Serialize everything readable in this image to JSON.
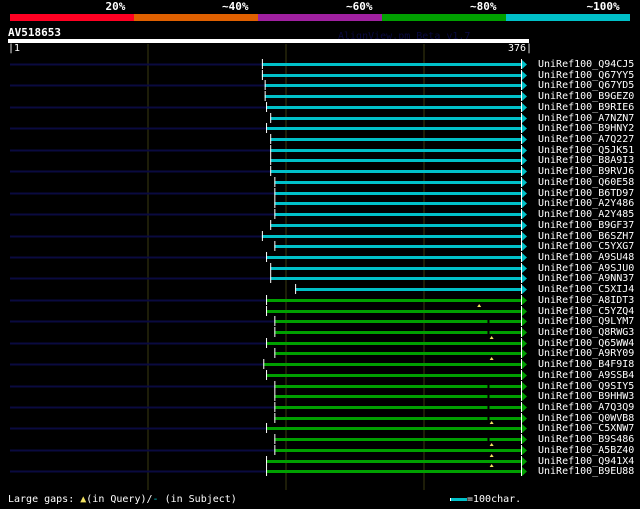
{
  "color_scale": [
    {
      "label": "20%",
      "color": "#ff0022"
    },
    {
      "label": "~40%",
      "color": "#e06000"
    },
    {
      "label": "~60%",
      "color": "#a020a0"
    },
    {
      "label": "~80%",
      "color": "#00a000"
    },
    {
      "label": "~100%",
      "color": "#00c0c8"
    }
  ],
  "query": {
    "id": "AV518653",
    "start_label": "|1",
    "end_label": "376|",
    "length": 376
  },
  "version_text": "AlignView.pm Beta v1.7",
  "legend": {
    "gaps_prefix": "Large gaps: ",
    "query_gap": "(in Query)/",
    "subject_gap": "(in Subject)",
    "scale_label": "=100char."
  },
  "chart_data": {
    "type": "alignment",
    "x_range": [
      1,
      376
    ],
    "hits": [
      {
        "label": "UniRef100_Q94CJ5",
        "start": 183,
        "end": 370,
        "identity": "~100%"
      },
      {
        "label": "UniRef100_Q67YY5",
        "start": 183,
        "end": 370,
        "identity": "~100%"
      },
      {
        "label": "UniRef100_Q67YD5",
        "start": 185,
        "end": 370,
        "identity": "~100%"
      },
      {
        "label": "UniRef100_B9GEZ0",
        "start": 185,
        "end": 370,
        "identity": "~100%"
      },
      {
        "label": "UniRef100_B9RIE6",
        "start": 186,
        "end": 370,
        "identity": "~100%"
      },
      {
        "label": "UniRef100_A7NZN7",
        "start": 189,
        "end": 370,
        "identity": "~100%"
      },
      {
        "label": "UniRef100_B9HNY2",
        "start": 186,
        "end": 370,
        "identity": "~100%"
      },
      {
        "label": "UniRef100_A7Q227",
        "start": 189,
        "end": 370,
        "identity": "~100%"
      },
      {
        "label": "UniRef100_Q5JK51",
        "start": 189,
        "end": 370,
        "identity": "~100%"
      },
      {
        "label": "UniRef100_B8A9I3",
        "start": 189,
        "end": 370,
        "identity": "~100%"
      },
      {
        "label": "UniRef100_B9RVJ6",
        "start": 189,
        "end": 370,
        "identity": "~100%"
      },
      {
        "label": "UniRef100_Q60E58",
        "start": 192,
        "end": 370,
        "identity": "~100%"
      },
      {
        "label": "UniRef100_B6TD97",
        "start": 192,
        "end": 370,
        "identity": "~100%"
      },
      {
        "label": "UniRef100_A2Y486",
        "start": 192,
        "end": 370,
        "identity": "~100%"
      },
      {
        "label": "UniRef100_A2Y485",
        "start": 192,
        "end": 370,
        "identity": "~100%"
      },
      {
        "label": "UniRef100_B9GF37",
        "start": 189,
        "end": 370,
        "identity": "~100%"
      },
      {
        "label": "UniRef100_B6SZH7",
        "start": 183,
        "end": 370,
        "identity": "~100%"
      },
      {
        "label": "UniRef100_C5YXG7",
        "start": 192,
        "end": 370,
        "identity": "~100%"
      },
      {
        "label": "UniRef100_A9SU48",
        "start": 186,
        "end": 370,
        "identity": "~100%"
      },
      {
        "label": "UniRef100_A9SJU0",
        "start": 189,
        "end": 370,
        "identity": "~100%"
      },
      {
        "label": "UniRef100_A9NN37",
        "start": 189,
        "end": 370,
        "identity": "~100%"
      },
      {
        "label": "UniRef100_C5XIJ4",
        "start": 207,
        "end": 370,
        "identity": "~100%"
      },
      {
        "label": "UniRef100_A8IDT3",
        "start": 186,
        "end": 370,
        "identity": "~80%"
      },
      {
        "label": "UniRef100_C5YZQ4",
        "start": 186,
        "end": 370,
        "identity": "~80%",
        "query_gap": 340
      },
      {
        "label": "UniRef100_Q9LYM7",
        "start": 192,
        "end": 370,
        "identity": "~80%",
        "subject_gap": 346
      },
      {
        "label": "UniRef100_Q8RWG3",
        "start": 192,
        "end": 370,
        "identity": "~80%",
        "subject_gap": 346
      },
      {
        "label": "UniRef100_Q65WW4",
        "start": 186,
        "end": 370,
        "identity": "~80%",
        "query_gap": 349
      },
      {
        "label": "UniRef100_A9RY09",
        "start": 192,
        "end": 370,
        "identity": "~80%"
      },
      {
        "label": "UniRef100_B4F9I8",
        "start": 184,
        "end": 370,
        "identity": "~80%",
        "query_gap": 349
      },
      {
        "label": "UniRef100_A9SSB4",
        "start": 186,
        "end": 370,
        "identity": "~80%"
      },
      {
        "label": "UniRef100_Q9SIY5",
        "start": 192,
        "end": 370,
        "identity": "~80%",
        "subject_gap": 346
      },
      {
        "label": "UniRef100_B9HHW3",
        "start": 192,
        "end": 370,
        "identity": "~80%",
        "subject_gap": 346
      },
      {
        "label": "UniRef100_A7Q3Q9",
        "start": 192,
        "end": 370,
        "identity": "~80%",
        "subject_gap": 346
      },
      {
        "label": "UniRef100_Q0WVB8",
        "start": 192,
        "end": 370,
        "identity": "~80%",
        "subject_gap": 346
      },
      {
        "label": "UniRef100_C5XNW7",
        "start": 186,
        "end": 370,
        "identity": "~80%",
        "query_gap": 349
      },
      {
        "label": "UniRef100_B9S486",
        "start": 192,
        "end": 370,
        "identity": "~80%",
        "subject_gap": 346
      },
      {
        "label": "UniRef100_A5BZ40",
        "start": 192,
        "end": 370,
        "identity": "~80%",
        "query_gap": 349
      },
      {
        "label": "UniRef100_Q941X4",
        "start": 186,
        "end": 370,
        "identity": "~80%",
        "query_gap": 349
      },
      {
        "label": "UniRef100_B9EU88",
        "start": 186,
        "end": 370,
        "identity": "~80%",
        "query_gap": 349
      }
    ]
  }
}
